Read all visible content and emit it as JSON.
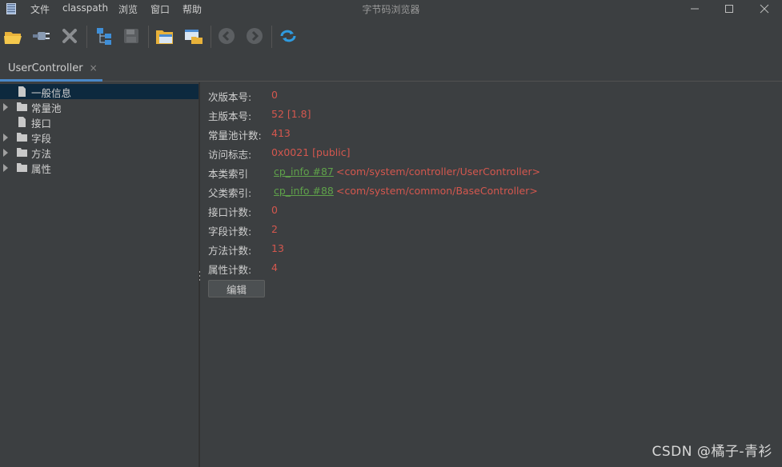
{
  "window": {
    "title": "字节码浏览器"
  },
  "menu": [
    "文件",
    "classpath",
    "浏览",
    "窗口",
    "帮助"
  ],
  "toolbar": {
    "icons": [
      "open-folder-icon",
      "plug-icon",
      "close-x-icon",
      "tree-structure-icon",
      "save-disk-icon",
      "open-folder-blue-icon",
      "window-folder-icon",
      "back-arrow-icon",
      "forward-arrow-icon",
      "refresh-icon"
    ]
  },
  "tabs": [
    {
      "label": "UserController",
      "close": "×"
    }
  ],
  "tree": {
    "items": [
      {
        "label": "一般信息",
        "type": "file",
        "selected": true
      },
      {
        "label": "常量池",
        "type": "folder",
        "expandable": true
      },
      {
        "label": "接口",
        "type": "file"
      },
      {
        "label": "字段",
        "type": "folder",
        "expandable": true
      },
      {
        "label": "方法",
        "type": "folder",
        "expandable": true
      },
      {
        "label": "属性",
        "type": "folder",
        "expandable": true
      }
    ]
  },
  "info": {
    "minor_version": {
      "label": "次版本号:",
      "value": "0"
    },
    "major_version": {
      "label": "主版本号:",
      "value": "52 [1.8]"
    },
    "constant_pool_count": {
      "label": "常量池计数:",
      "value": "413"
    },
    "access_flags": {
      "label": "访问标志:",
      "value": "0x0021 [public]"
    },
    "this_class": {
      "label": "本类索引",
      "link": "cp_info #87",
      "ref": "<com/system/controller/UserController>"
    },
    "super_class": {
      "label": "父类索引:",
      "link": "cp_info #88",
      "ref": "<com/system/common/BaseController>"
    },
    "interfaces_count": {
      "label": "接口计数:",
      "value": "0"
    },
    "fields_count": {
      "label": "字段计数:",
      "value": "2"
    },
    "methods_count": {
      "label": "方法计数:",
      "value": "13"
    },
    "attributes_count": {
      "label": "属性计数:",
      "value": "4"
    },
    "edit_button": "编辑"
  },
  "watermark": "CSDN @橘子-青衫",
  "colors": {
    "background": "#3c3f41",
    "value_red": "#d4574e",
    "link_green": "#5fa24a",
    "selection": "#0d293e",
    "tab_accent": "#4a88c7"
  }
}
